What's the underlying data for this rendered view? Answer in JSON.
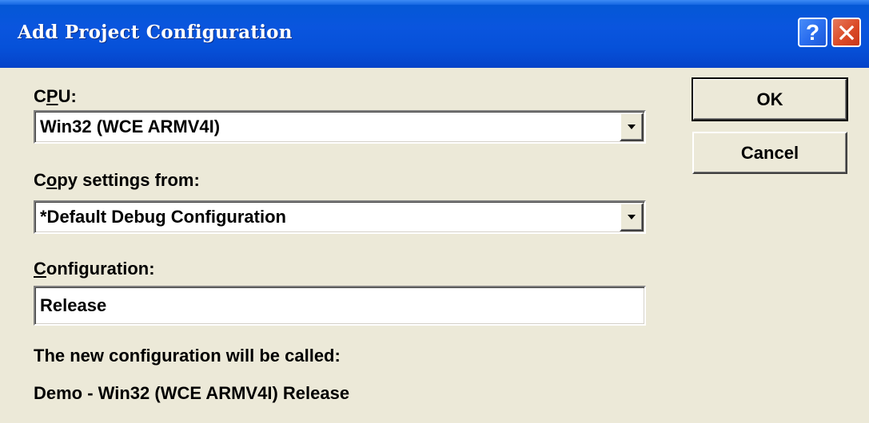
{
  "window": {
    "title": "Add Project Configuration",
    "help_symbol": "?",
    "title_bar_color": "#0a55de",
    "close_color": "#db4b28"
  },
  "cpu": {
    "label_pre": "C",
    "label_accel": "P",
    "label_post": "U:",
    "value": "Win32 (WCE ARMV4I)"
  },
  "copy_settings": {
    "label_pre": "C",
    "label_accel": "o",
    "label_post": "py settings from:",
    "value": "*Default Debug Configuration"
  },
  "configuration": {
    "label_accel": "C",
    "label_post": "onfiguration:",
    "value": "Release"
  },
  "result": {
    "caption": "The new configuration will be called:",
    "name": "Demo - Win32 (WCE ARMV4I) Release"
  },
  "buttons": {
    "ok_label": "OK",
    "cancel_label": "Cancel"
  },
  "icons": {
    "help": "help-icon",
    "close": "close-icon",
    "dropdown": "dropdown-arrow-icon"
  }
}
